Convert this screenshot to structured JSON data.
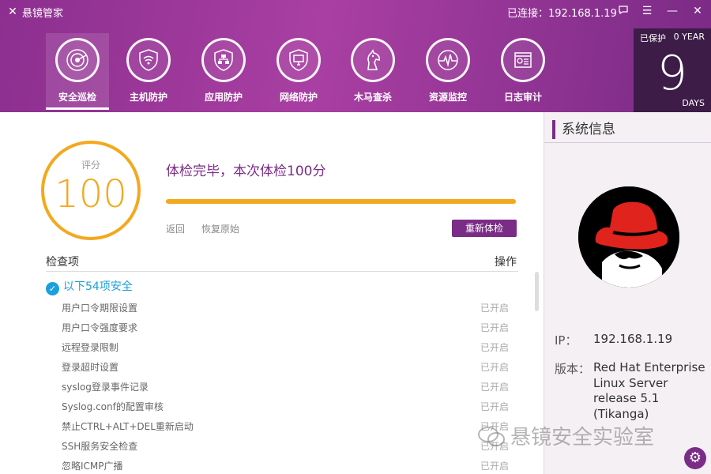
{
  "titlebar": {
    "app_title": "悬镜管家",
    "connection": "已连接：192.168.1.19",
    "buttons": [
      "feedback-icon",
      "menu-icon",
      "minimize-icon",
      "close-icon"
    ]
  },
  "nav": {
    "items": [
      {
        "label": "安全巡检",
        "icon": "radar-icon",
        "active": true
      },
      {
        "label": "主机防护",
        "icon": "wifi-shield-icon",
        "active": false
      },
      {
        "label": "应用防护",
        "icon": "network-shield-icon",
        "active": false
      },
      {
        "label": "网络防护",
        "icon": "monitor-shield-icon",
        "active": false
      },
      {
        "label": "木马查杀",
        "icon": "horse-icon",
        "active": false
      },
      {
        "label": "资源监控",
        "icon": "pulse-icon",
        "active": false
      },
      {
        "label": "日志审计",
        "icon": "log-icon",
        "active": false
      }
    ]
  },
  "protection": {
    "label": "已保护",
    "year": "0 YEAR",
    "days": "9",
    "unit": "DAYS"
  },
  "scan": {
    "score_label": "评分",
    "score": "100",
    "result_text": "体检完毕，本次体检100分",
    "progress": 1.0,
    "back_link": "返回",
    "restore_link": "恢复原始",
    "recheck_button": "重新体检"
  },
  "table": {
    "col_item": "检查项",
    "col_action": "操作",
    "safe_header": "以下54项安全",
    "rows": [
      {
        "name": "用户口令期限设置",
        "status": "已开启"
      },
      {
        "name": "用户口令强度要求",
        "status": "已开启"
      },
      {
        "name": "远程登录限制",
        "status": "已开启"
      },
      {
        "name": "登录超时设置",
        "status": "已开启"
      },
      {
        "name": "syslog登录事件记录",
        "status": "已开启"
      },
      {
        "name": "Syslog.conf的配置审核",
        "status": "已开启"
      },
      {
        "name": "禁止CTRL+ALT+DEL重新启动",
        "status": "已开启"
      },
      {
        "name": "SSH服务安全检查",
        "status": "已开启"
      },
      {
        "name": "忽略ICMP广播",
        "status": "已开启"
      }
    ]
  },
  "sysinfo": {
    "title": "系统信息",
    "ip_label": "IP：",
    "ip_value": "192.168.1.19",
    "version_label": "版本：",
    "version_value": "Red Hat Enterprise Linux Server release 5.1 (Tikanga)"
  },
  "watermark": "悬镜安全实验室",
  "colors": {
    "accent": "#7b2c86",
    "score": "#f4a81e",
    "safe": "#1aa0dc"
  }
}
